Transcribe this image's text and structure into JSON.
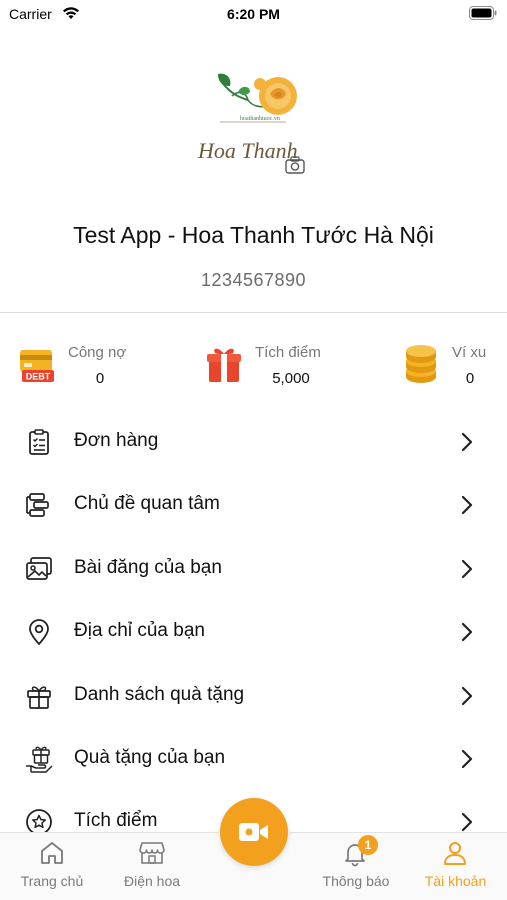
{
  "status_bar": {
    "carrier": "Carrier",
    "time": "6:20 PM"
  },
  "logo": {
    "brand_text": "Hoa Thanh",
    "url_text": "hoathanhtuoc.vn"
  },
  "profile": {
    "name": "Test App - Hoa Thanh Tước Hà Nội",
    "phone": "1234567890"
  },
  "stats": [
    {
      "label": "Công nợ",
      "value": "0",
      "icon": "debt-card-icon"
    },
    {
      "label": "Tích điểm",
      "value": "5,000",
      "icon": "gift-box-icon"
    },
    {
      "label": "Ví xu",
      "value": "0",
      "icon": "coins-icon"
    }
  ],
  "menu": [
    {
      "label": "Đơn hàng",
      "icon": "order-list-icon"
    },
    {
      "label": "Chủ đề quan tâm",
      "icon": "topics-icon"
    },
    {
      "label": "Bài đăng của bạn",
      "icon": "gallery-icon"
    },
    {
      "label": "Địa chỉ của bạn",
      "icon": "location-pin-icon"
    },
    {
      "label": "Danh sách quà tặng",
      "icon": "gift-icon"
    },
    {
      "label": "Quà tặng của bạn",
      "icon": "gift-hand-icon"
    },
    {
      "label": "Tích điểm",
      "icon": "star-badge-icon"
    }
  ],
  "tabbar": {
    "tabs": [
      {
        "label": "Trang chủ",
        "icon": "home-icon"
      },
      {
        "label": "Điện hoa",
        "icon": "shop-icon"
      },
      {
        "label": "Thông báo",
        "icon": "bell-icon",
        "badge": "1"
      },
      {
        "label": "Tài khoản",
        "icon": "user-icon",
        "active": true
      }
    ],
    "center_button_icon": "video-camera-icon"
  },
  "colors": {
    "accent": "#f2a01e",
    "debt_red": "#e8452c",
    "gift_red": "#e8452c",
    "coin_yellow": "#f5b324"
  }
}
